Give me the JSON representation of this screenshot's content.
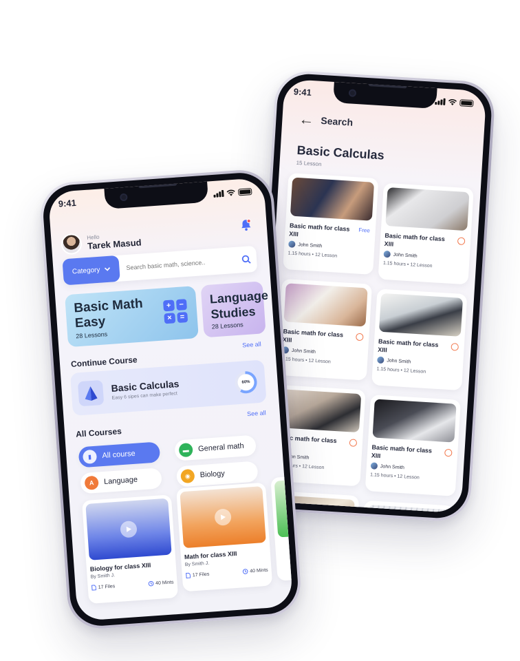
{
  "home": {
    "status_time": "9:41",
    "greeting": "Hello",
    "user_name": "Tarek Masud",
    "search": {
      "category_label": "Category",
      "placeholder": "Search basic math, science.."
    },
    "banners": [
      {
        "title": "Basic Math Easy",
        "lessons": "28 Lessons"
      },
      {
        "title": "Language Studies",
        "lessons": "28 Lessons"
      }
    ],
    "see_all": "See all",
    "continue_course": {
      "heading": "Continue Course",
      "title": "Basic Calculas",
      "subtitle": "Easy 6 sipes can make perfect",
      "progress_label": "60%",
      "progress": 0.6
    },
    "all_courses": {
      "heading": "All Courses",
      "chips": [
        {
          "label": "All course",
          "active": true,
          "icon": "book-icon",
          "color": "#5a79f0"
        },
        {
          "label": "General math",
          "active": false,
          "icon": "ruler-icon",
          "color": "#2fb35a"
        },
        {
          "label": "Language",
          "active": false,
          "icon": "translate-icon",
          "color": "#f07a3a"
        },
        {
          "label": "Biology",
          "active": false,
          "icon": "microscope-icon",
          "color": "#f2a623"
        }
      ],
      "cards": [
        {
          "title": "Biology for class XIII",
          "by": "By Smith J.",
          "files": "17 Files",
          "duration": "40 Mints"
        },
        {
          "title": "Math for class XIII",
          "by": "By Smith J.",
          "files": "17 Files",
          "duration": "40 Mints"
        }
      ]
    }
  },
  "search_screen": {
    "status_time": "9:41",
    "header": "Search",
    "title": "Basic Calculas",
    "subtitle": "15 Lesson",
    "cards": [
      {
        "title": "Basic math for class XIII",
        "author": "John Smith",
        "meta": "1.15 hours • 12 Lesson",
        "badge": "Free"
      },
      {
        "title": "Basic math for class XIII",
        "author": "John Smith",
        "meta": "1.15 hours • 12 Lesson",
        "badge": ""
      },
      {
        "title": "Basic math for class XIII",
        "author": "John Smith",
        "meta": "1.15 hours • 12 Lesson",
        "badge": ""
      },
      {
        "title": "Basic math for class XIII",
        "author": "John Smith",
        "meta": "1.15 hours • 12 Lesson",
        "badge": ""
      },
      {
        "title": "Basic math for class XIII",
        "author": "John Smith",
        "meta": "1.15 hours • 12 Lesson",
        "badge": ""
      },
      {
        "title": "Basic math for class XIII",
        "author": "John Smith",
        "meta": "1.15 hours • 12 Lesson",
        "badge": ""
      }
    ]
  },
  "colors": {
    "accent": "#4f6ef7",
    "award": "#f27a4f"
  }
}
